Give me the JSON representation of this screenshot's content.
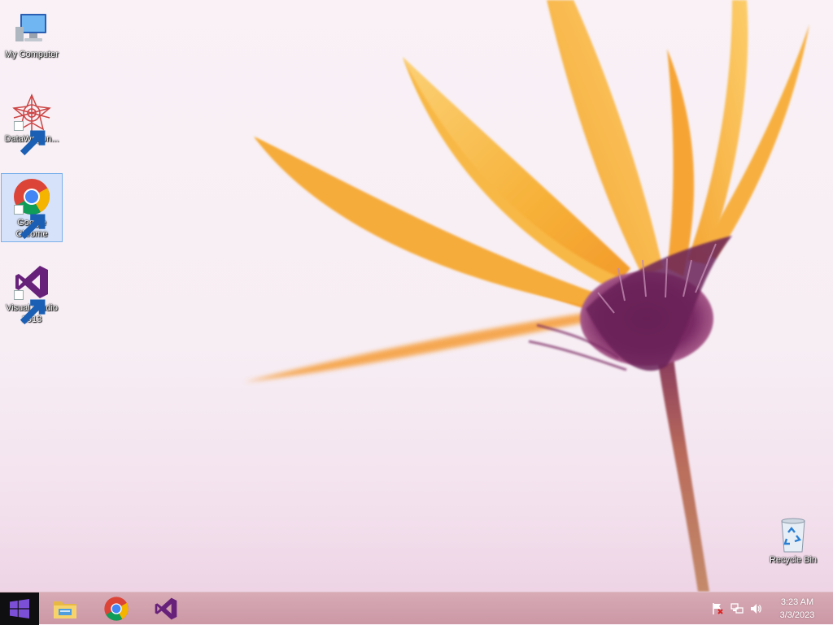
{
  "desktop": {
    "icons": [
      {
        "label": "My Computer",
        "icon": "monitor-icon",
        "selected": false
      },
      {
        "label": "DataWagon...",
        "icon": "datawagon-icon",
        "selected": false
      },
      {
        "label": "Google Chrome",
        "icon": "chrome-icon",
        "selected": true
      },
      {
        "label": "Visual Studio 2013",
        "icon": "visual-studio-icon",
        "selected": false
      }
    ],
    "recycle_bin": {
      "label": "Recycle Bin",
      "icon": "recycle-bin-icon"
    }
  },
  "taskbar": {
    "start": {
      "icon": "windows-logo-icon"
    },
    "pinned": [
      {
        "name": "File Explorer",
        "icon": "folder-icon"
      },
      {
        "name": "Google Chrome",
        "icon": "chrome-icon"
      },
      {
        "name": "Visual Studio",
        "icon": "visual-studio-icon"
      }
    ],
    "tray": {
      "icons": [
        "action-center-flag-icon",
        "network-icon",
        "volume-icon"
      ],
      "time": "3:23 AM",
      "date": "3/3/2023"
    }
  },
  "colors": {
    "start_button": "#0f0f12",
    "taskbar": "#d0a0ae",
    "selection": "#add2ff",
    "petal": "#f7b23a",
    "flower_center": "#7a2a64"
  }
}
